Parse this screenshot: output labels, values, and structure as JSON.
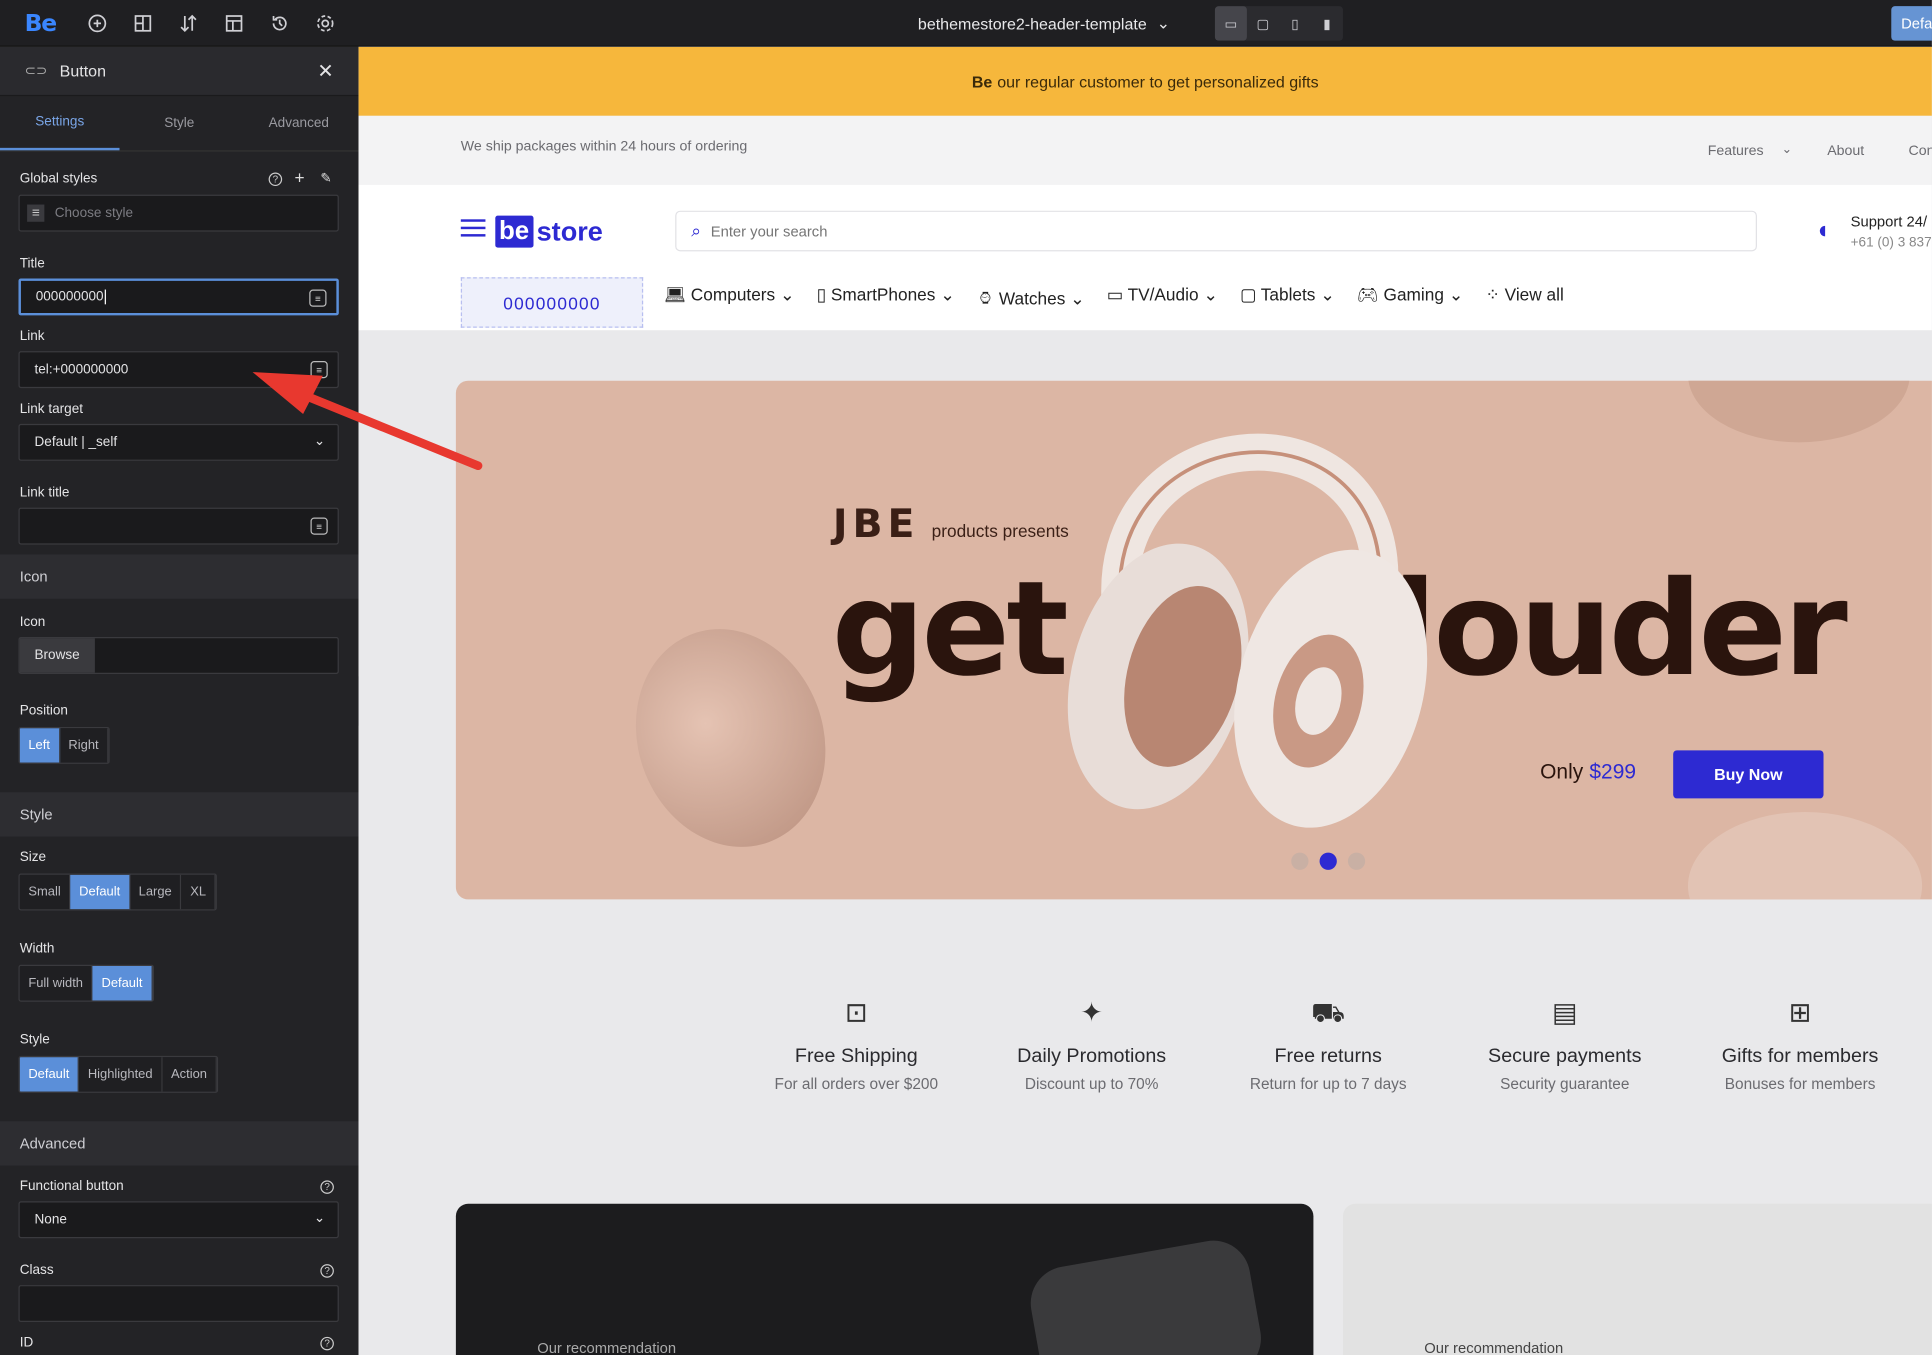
{
  "topbar": {
    "logo": "Be",
    "template": "bethemestore2-header-template",
    "default_label": "Defa",
    "icons": [
      "add-icon",
      "layout-icon",
      "sort-icon",
      "template-icon",
      "history-icon",
      "settings-icon"
    ]
  },
  "sidebar": {
    "element": "Button",
    "tabs": [
      "Settings",
      "Style",
      "Advanced"
    ],
    "global_styles": "Global styles",
    "choose_style": "Choose style",
    "title_label": "Title",
    "title_value": "000000000",
    "link_label": "Link",
    "link_value": "tel:+000000000",
    "target_label": "Link target",
    "target_value": "Default | _self",
    "link_title_label": "Link title",
    "icon_section": "Icon",
    "icon_label": "Icon",
    "browse": "Browse",
    "position_label": "Position",
    "position_opts": [
      "Left",
      "Right"
    ],
    "style_section": "Style",
    "size_label": "Size",
    "size_opts": [
      "Small",
      "Default",
      "Large",
      "XL"
    ],
    "width_label": "Width",
    "width_opts": [
      "Full width",
      "Default"
    ],
    "style_label": "Style",
    "style_opts": [
      "Default",
      "Highlighted",
      "Action"
    ],
    "advanced_section": "Advanced",
    "functional_label": "Functional button",
    "functional_value": "None",
    "class_label": "Class",
    "id_label": "ID"
  },
  "site": {
    "promo_bold": "Be",
    "promo_text": "our regular customer to get personalized gifts",
    "ship_text": "We ship packages within 24 hours of ordering",
    "nav_top": [
      "Features",
      "About",
      "Con"
    ],
    "logo_be": "be",
    "logo_store": "store",
    "search_placeholder": "Enter your search",
    "support": "Support 24/",
    "support_phone": "+61 (0) 3 837",
    "button_label": "000000000",
    "categories": [
      "Computers",
      "SmartPhones",
      "Watches",
      "TV/Audio",
      "Tablets",
      "Gaming",
      "View all"
    ],
    "hero": {
      "brand": "JBE",
      "presents": "products presents",
      "word1": "get",
      "word2": "louder",
      "only": "Only",
      "price": "$299",
      "buy": "Buy Now"
    },
    "features": [
      {
        "title": "Free Shipping",
        "sub": "For all orders over $200",
        "icon": "box-icon"
      },
      {
        "title": "Daily Promotions",
        "sub": "Discount up to 70%",
        "icon": "promo-icon"
      },
      {
        "title": "Free returns",
        "sub": "Return for up to 7 days",
        "icon": "truck-icon"
      },
      {
        "title": "Secure payments",
        "sub": "Security guarantee",
        "icon": "wallet-icon"
      },
      {
        "title": "Gifts for members",
        "sub": "Bonuses for members",
        "icon": "gift-icon"
      }
    ],
    "recommend1": "Our recommendation",
    "recommend2": "Our recommendation"
  },
  "colors": {
    "accent": "#5b8fd9",
    "brand_blue": "#2d2ad2",
    "promo": "#f6b73c",
    "hero": "#dcb6a4"
  }
}
